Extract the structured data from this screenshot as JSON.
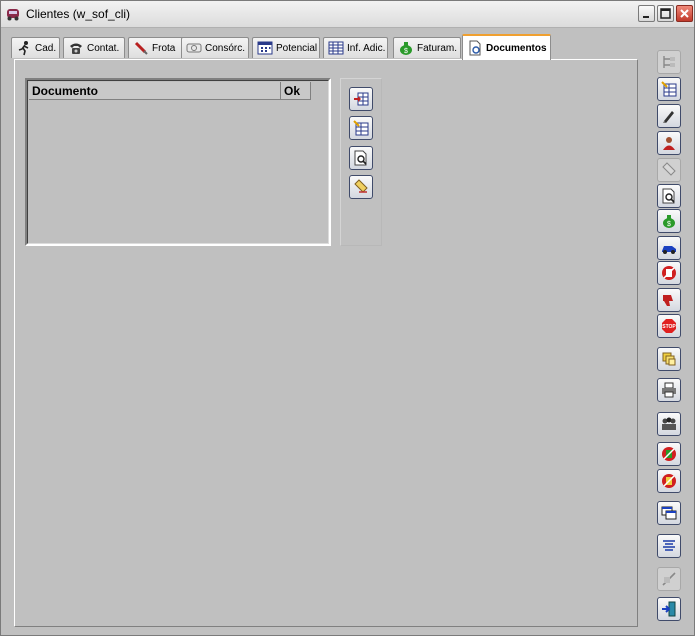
{
  "window": {
    "title": "Clientes (w_sof_cli)",
    "icon": "car-icon"
  },
  "tabs": [
    {
      "label": "Cad.",
      "icon": "running-man-icon",
      "active": false
    },
    {
      "label": "Contat.",
      "icon": "telephone-icon",
      "active": false
    },
    {
      "label": "Frota",
      "icon": "wrench-icon",
      "active": false
    },
    {
      "label": "Consórc.",
      "icon": "card-icon",
      "active": false
    },
    {
      "label": "Potencial",
      "icon": "grid-dots-icon",
      "active": false
    },
    {
      "label": "Inf. Adic.",
      "icon": "table-icon",
      "active": false
    },
    {
      "label": "Faturam.",
      "icon": "money-bag-icon",
      "active": false
    },
    {
      "label": "Documentos",
      "icon": "document-icon",
      "active": true
    }
  ],
  "documents_grid": {
    "columns": [
      "Documento",
      "Ok"
    ],
    "rows": []
  },
  "colors": {
    "window_bg": "#c0c0c0",
    "active_tab_accent": "#f0a030",
    "button_border": "#404b6a"
  }
}
